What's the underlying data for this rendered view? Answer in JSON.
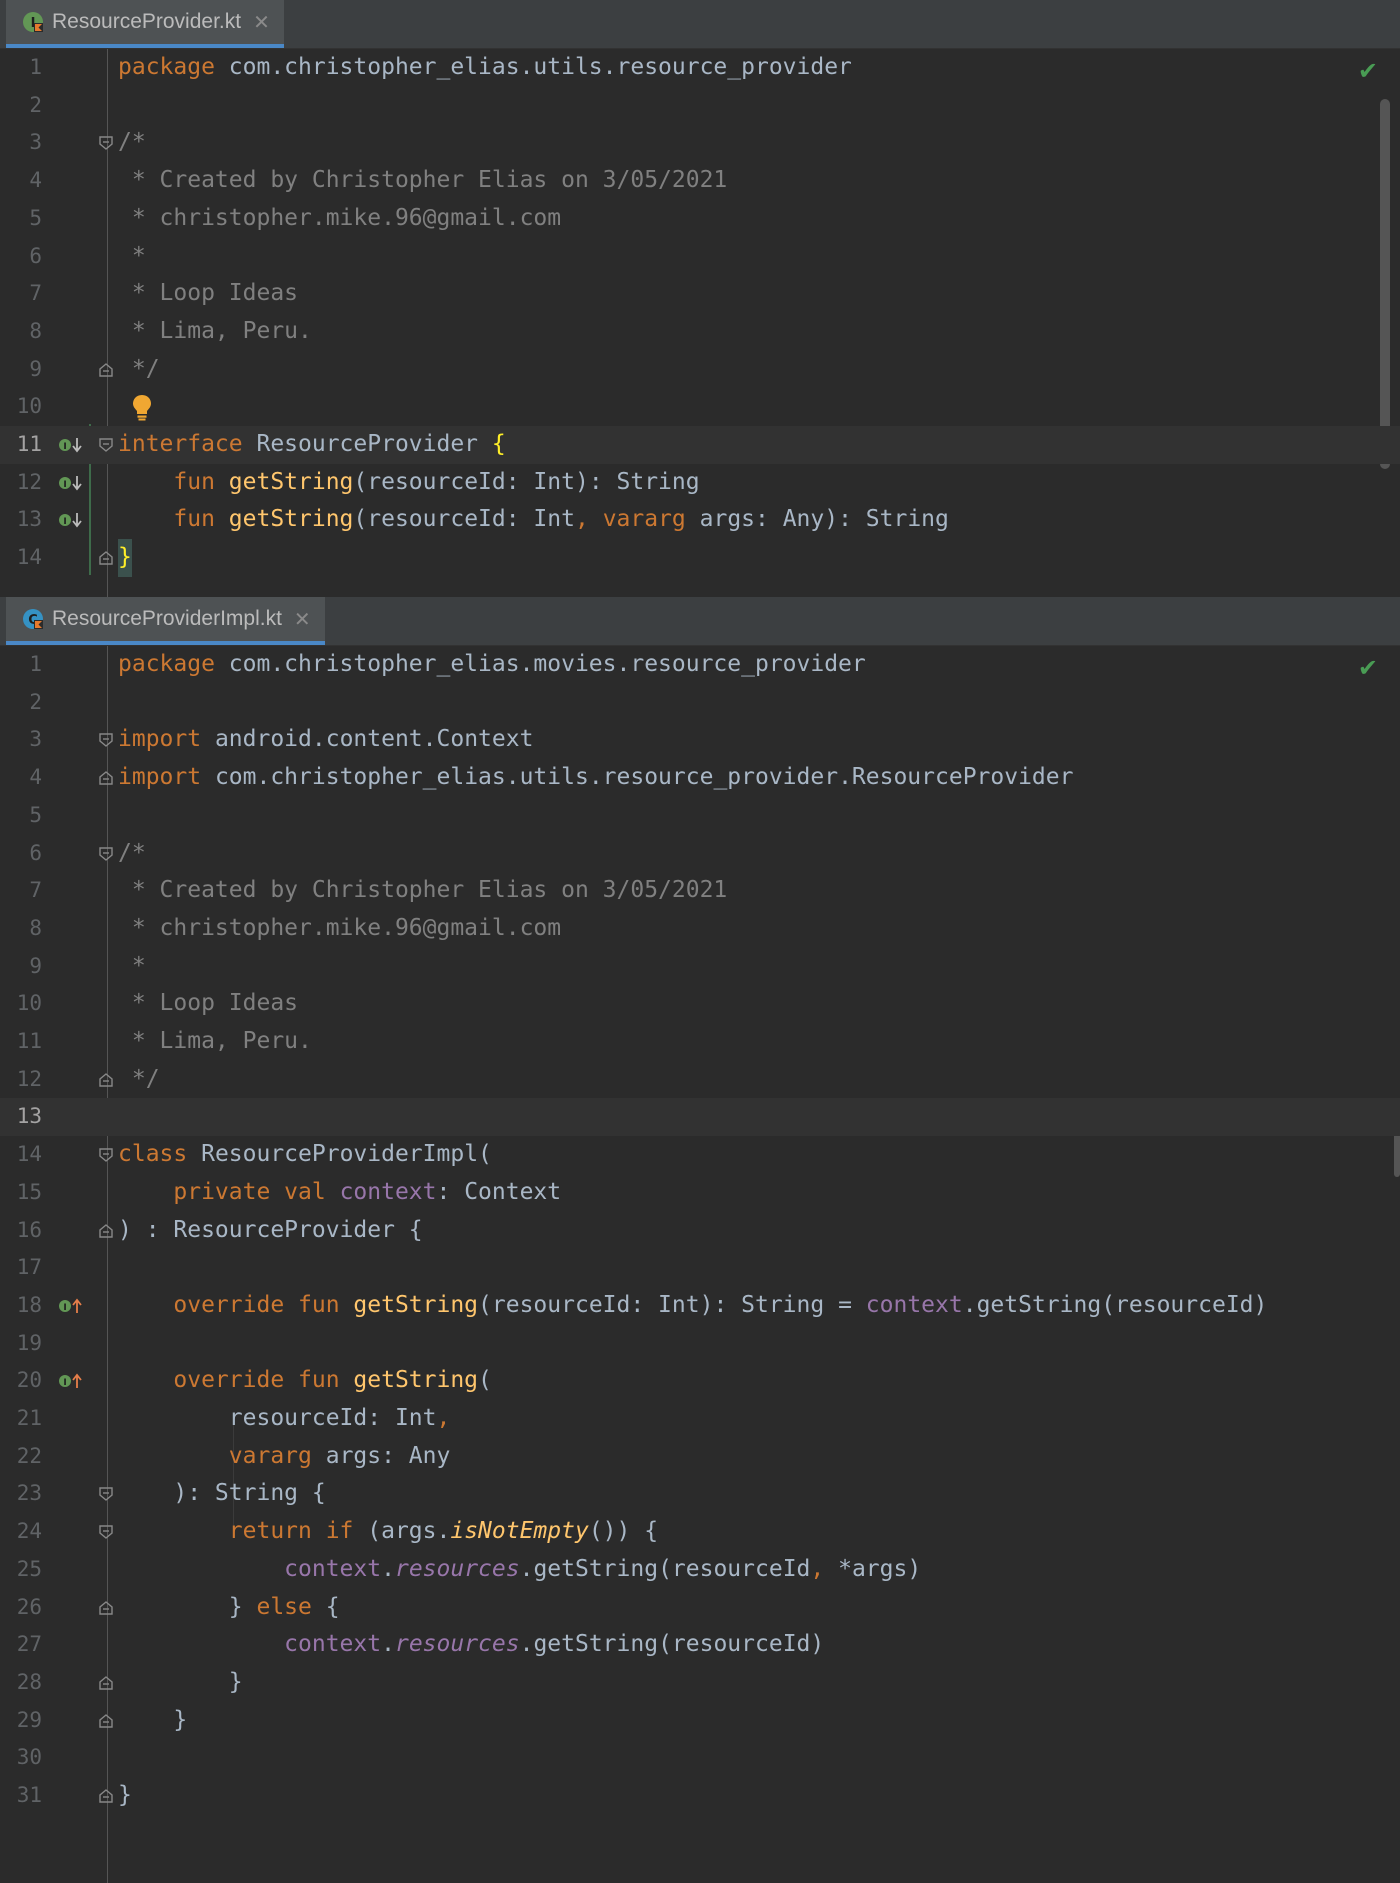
{
  "tabs": [
    {
      "label": "ResourceProvider.kt",
      "close": "✕"
    },
    {
      "label": "ResourceProviderImpl.kt",
      "close": "✕"
    }
  ],
  "status_icon": "checkmark-icon",
  "file1": {
    "lines": [
      {
        "n": "1"
      },
      {
        "n": "2"
      },
      {
        "n": "3"
      },
      {
        "n": "4"
      },
      {
        "n": "5"
      },
      {
        "n": "6"
      },
      {
        "n": "7"
      },
      {
        "n": "8"
      },
      {
        "n": "9"
      },
      {
        "n": "10"
      },
      {
        "n": "11"
      },
      {
        "n": "12"
      },
      {
        "n": "13"
      },
      {
        "n": "14"
      }
    ],
    "t": {
      "l1_kw": "package",
      "l1_rest": " com.christopher_elias.utils.resource_provider",
      "l3": "/*",
      "l4": " * Created by Christopher Elias on 3/05/2021",
      "l5": " * christopher.mike.96@gmail.com",
      "l6": " *",
      "l7": " * Loop Ideas",
      "l8": " * Lima, Peru.",
      "l9": " */",
      "l11_kw": "interface",
      "l11_name": " ResourceProvider ",
      "l11_brace": "{",
      "l12_indent": "    ",
      "l12_kw": "fun",
      "l12_fn": " getString",
      "l12_rest": "(resourceId: Int): String",
      "l13_indent": "    ",
      "l13_kw": "fun",
      "l13_fn": " getString",
      "l13_a": "(resourceId: Int",
      "l13_comma": ",",
      "l13_kw2": " vararg",
      "l13_b": " args: Any): String",
      "l14": "}"
    }
  },
  "file2": {
    "lines": [
      {
        "n": "1"
      },
      {
        "n": "2"
      },
      {
        "n": "3"
      },
      {
        "n": "4"
      },
      {
        "n": "5"
      },
      {
        "n": "6"
      },
      {
        "n": "7"
      },
      {
        "n": "8"
      },
      {
        "n": "9"
      },
      {
        "n": "10"
      },
      {
        "n": "11"
      },
      {
        "n": "12"
      },
      {
        "n": "13"
      },
      {
        "n": "14"
      },
      {
        "n": "15"
      },
      {
        "n": "16"
      },
      {
        "n": "17"
      },
      {
        "n": "18"
      },
      {
        "n": "19"
      },
      {
        "n": "20"
      },
      {
        "n": "21"
      },
      {
        "n": "22"
      },
      {
        "n": "23"
      },
      {
        "n": "24"
      },
      {
        "n": "25"
      },
      {
        "n": "26"
      },
      {
        "n": "27"
      },
      {
        "n": "28"
      },
      {
        "n": "29"
      },
      {
        "n": "30"
      },
      {
        "n": "31"
      }
    ],
    "t": {
      "l1_kw": "package",
      "l1_rest": " com.christopher_elias.movies.resource_provider",
      "l3_kw": "import",
      "l3_rest": " android.content.Context",
      "l4_kw": "import",
      "l4_rest": " com.christopher_elias.utils.resource_provider.ResourceProvider",
      "l6": "/*",
      "l7": " * Created by Christopher Elias on 3/05/2021",
      "l8": " * christopher.mike.96@gmail.com",
      "l9": " *",
      "l10": " * Loop Ideas",
      "l11": " * Lima, Peru.",
      "l12": " */",
      "l14_kw": "class",
      "l14_rest": " ResourceProviderImpl(",
      "l15_indent": "    ",
      "l15_kw": "private val",
      "l15_pr": " context",
      "l15_rest": ": Context",
      "l16": ") : ResourceProvider {",
      "l18_indent": "    ",
      "l18_kw": "override fun",
      "l18_fn": " getString",
      "l18_a": "(resourceId: Int): String = ",
      "l18_pr": "context",
      "l18_b": ".getString(resourceId)",
      "l20_indent": "    ",
      "l20_kw": "override fun",
      "l20_fn": " getString",
      "l20_rest": "(",
      "l21_indent": "        ",
      "l21_a": "resourceId: Int",
      "l21_comma": ",",
      "l22_indent": "        ",
      "l22_kw": "vararg",
      "l22_rest": " args: Any",
      "l23": "    ): String {",
      "l24_indent": "        ",
      "l24_kw": "return if",
      "l24_a": " (args.",
      "l24_fn": "isNotEmpty",
      "l24_b": "()) {",
      "l25_indent": "            ",
      "l25_pr": "context",
      "l25_dot": ".",
      "l25_res": "resources",
      "l25_a": ".getString(resourceId",
      "l25_comma": ",",
      "l25_b": " *args)",
      "l26_a": "        } ",
      "l26_kw": "else",
      "l26_b": " {",
      "l27_indent": "            ",
      "l27_pr": "context",
      "l27_dot": ".",
      "l27_res": "resources",
      "l27_rest": ".getString(resourceId)",
      "l28": "        }",
      "l29": "    }",
      "l31": "}"
    }
  }
}
